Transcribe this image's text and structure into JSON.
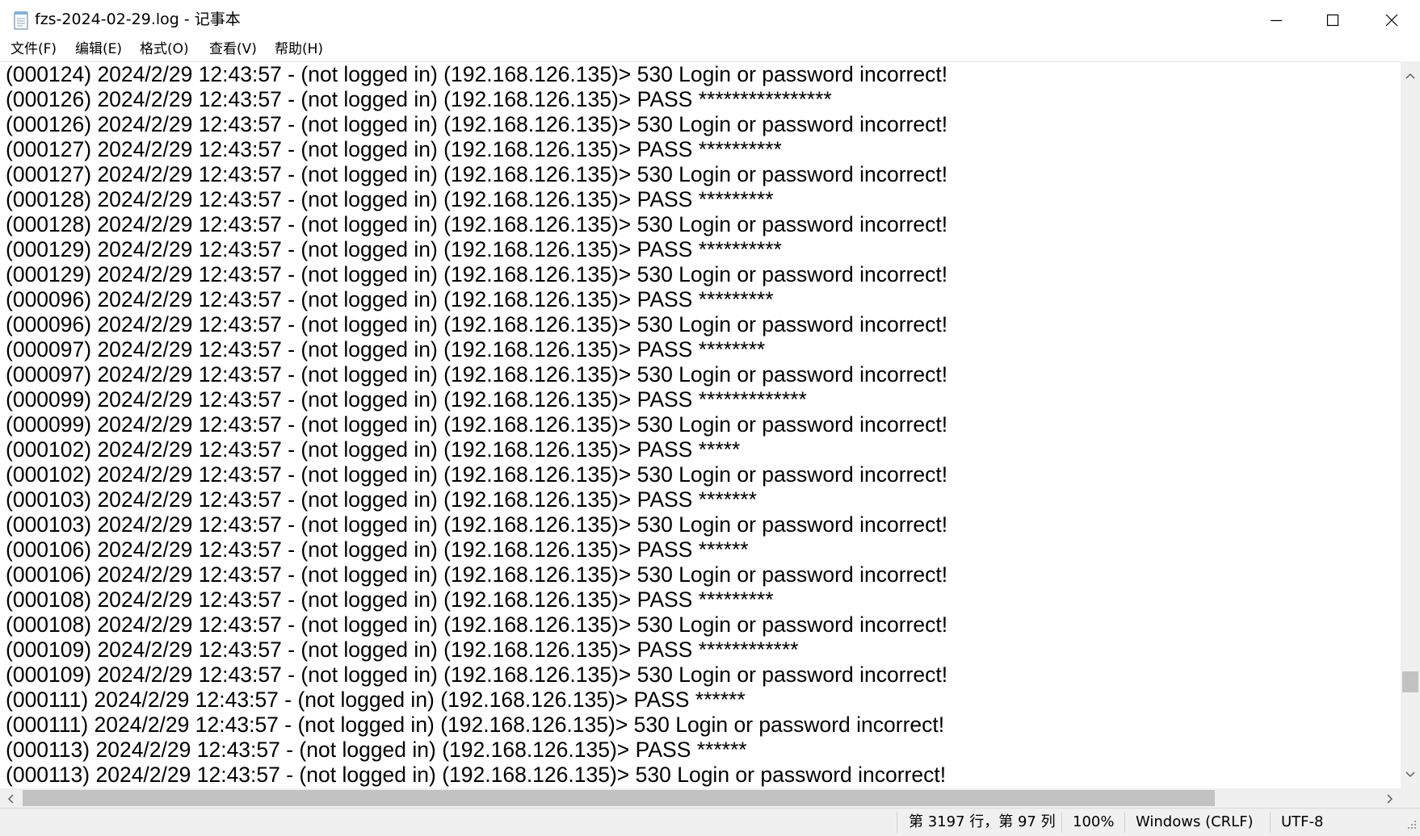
{
  "window": {
    "title": "fzs-2024-02-29.log - 记事本",
    "icon": "notepad-icon",
    "controls": {
      "minimize": "minimize-icon",
      "maximize": "maximize-icon",
      "close": "close-icon"
    }
  },
  "menu": {
    "file": "文件(F)",
    "edit": "编辑(E)",
    "format": "格式(O)",
    "view": "查看(V)",
    "help": "帮助(H)"
  },
  "lines": [
    "(000124) 2024/2/29 12:43:57 - (not logged in) (192.168.126.135)> 530 Login or password incorrect!",
    "(000126) 2024/2/29 12:43:57 - (not logged in) (192.168.126.135)> PASS ****************",
    "(000126) 2024/2/29 12:43:57 - (not logged in) (192.168.126.135)> 530 Login or password incorrect!",
    "(000127) 2024/2/29 12:43:57 - (not logged in) (192.168.126.135)> PASS **********",
    "(000127) 2024/2/29 12:43:57 - (not logged in) (192.168.126.135)> 530 Login or password incorrect!",
    "(000128) 2024/2/29 12:43:57 - (not logged in) (192.168.126.135)> PASS *********",
    "(000128) 2024/2/29 12:43:57 - (not logged in) (192.168.126.135)> 530 Login or password incorrect!",
    "(000129) 2024/2/29 12:43:57 - (not logged in) (192.168.126.135)> PASS **********",
    "(000129) 2024/2/29 12:43:57 - (not logged in) (192.168.126.135)> 530 Login or password incorrect!",
    "(000096) 2024/2/29 12:43:57 - (not logged in) (192.168.126.135)> PASS *********",
    "(000096) 2024/2/29 12:43:57 - (not logged in) (192.168.126.135)> 530 Login or password incorrect!",
    "(000097) 2024/2/29 12:43:57 - (not logged in) (192.168.126.135)> PASS ********",
    "(000097) 2024/2/29 12:43:57 - (not logged in) (192.168.126.135)> 530 Login or password incorrect!",
    "(000099) 2024/2/29 12:43:57 - (not logged in) (192.168.126.135)> PASS *************",
    "(000099) 2024/2/29 12:43:57 - (not logged in) (192.168.126.135)> 530 Login or password incorrect!",
    "(000102) 2024/2/29 12:43:57 - (not logged in) (192.168.126.135)> PASS *****",
    "(000102) 2024/2/29 12:43:57 - (not logged in) (192.168.126.135)> 530 Login or password incorrect!",
    "(000103) 2024/2/29 12:43:57 - (not logged in) (192.168.126.135)> PASS *******",
    "(000103) 2024/2/29 12:43:57 - (not logged in) (192.168.126.135)> 530 Login or password incorrect!",
    "(000106) 2024/2/29 12:43:57 - (not logged in) (192.168.126.135)> PASS ******",
    "(000106) 2024/2/29 12:43:57 - (not logged in) (192.168.126.135)> 530 Login or password incorrect!",
    "(000108) 2024/2/29 12:43:57 - (not logged in) (192.168.126.135)> PASS *********",
    "(000108) 2024/2/29 12:43:57 - (not logged in) (192.168.126.135)> 530 Login or password incorrect!",
    "(000109) 2024/2/29 12:43:57 - (not logged in) (192.168.126.135)> PASS ************",
    "(000109) 2024/2/29 12:43:57 - (not logged in) (192.168.126.135)> 530 Login or password incorrect!",
    "(000111) 2024/2/29 12:43:57 - (not logged in) (192.168.126.135)> PASS ******",
    "(000111) 2024/2/29 12:43:57 - (not logged in) (192.168.126.135)> 530 Login or password incorrect!",
    "(000113) 2024/2/29 12:43:57 - (not logged in) (192.168.126.135)> PASS ******",
    "(000113) 2024/2/29 12:43:57 - (not logged in) (192.168.126.135)> 530 Login or password incorrect!"
  ],
  "scrollbars": {
    "vertical_position": 0.92,
    "horizontal_position": 0.0
  },
  "status": {
    "position": "第 3197 行，第 97 列",
    "zoom": "100%",
    "line_ending": "Windows (CRLF)",
    "encoding": "UTF-8"
  }
}
